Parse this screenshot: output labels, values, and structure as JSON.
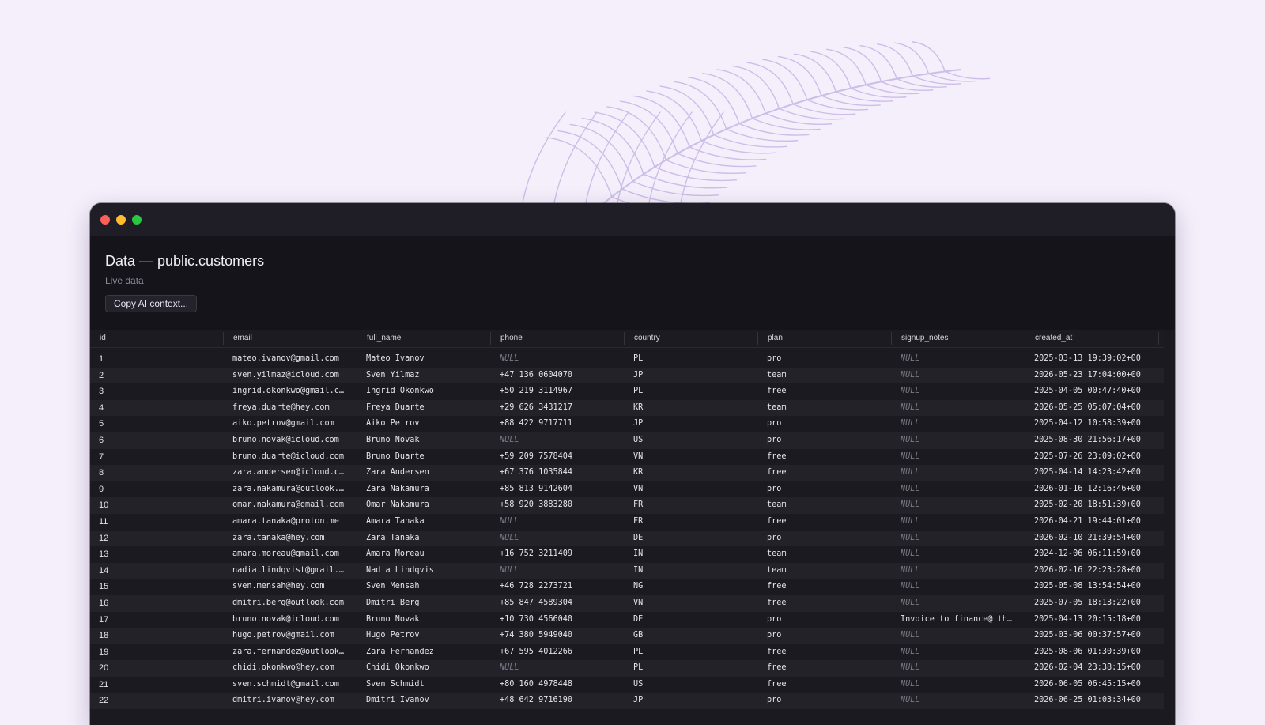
{
  "window": {
    "title": "Data — public.customers",
    "subtitle": "Live data",
    "copy_button_label": "Copy AI context..."
  },
  "table": {
    "columns": [
      "id",
      "email",
      "full_name",
      "phone",
      "country",
      "plan",
      "signup_notes",
      "created_at"
    ],
    "rows": [
      [
        "1",
        "mateo.ivanov@gmail.com",
        "Mateo Ivanov",
        "NULL",
        "PL",
        "pro",
        "NULL",
        "2025-03-13 19:39:02+00"
      ],
      [
        "2",
        "sven.yilmaz@icloud.com",
        "Sven Yilmaz",
        "+47 136 0604070",
        "JP",
        "team",
        "NULL",
        "2026-05-23 17:04:00+00"
      ],
      [
        "3",
        "ingrid.okonkwo@gmail.c…",
        "Ingrid Okonkwo",
        "+50 219 3114967",
        "PL",
        "free",
        "NULL",
        "2025-04-05 00:47:40+00"
      ],
      [
        "4",
        "freya.duarte@hey.com",
        "Freya Duarte",
        "+29 626 3431217",
        "KR",
        "team",
        "NULL",
        "2026-05-25 05:07:04+00"
      ],
      [
        "5",
        "aiko.petrov@gmail.com",
        "Aiko Petrov",
        "+88 422 9717711",
        "JP",
        "pro",
        "NULL",
        "2025-04-12 10:58:39+00"
      ],
      [
        "6",
        "bruno.novak@icloud.com",
        "Bruno Novak",
        "NULL",
        "US",
        "pro",
        "NULL",
        "2025-08-30 21:56:17+00"
      ],
      [
        "7",
        "bruno.duarte@icloud.com",
        "Bruno Duarte",
        "+59 209 7578404",
        "VN",
        "free",
        "NULL",
        "2025-07-26 23:09:02+00"
      ],
      [
        "8",
        "zara.andersen@icloud.c…",
        "Zara Andersen",
        "+67 376 1035844",
        "KR",
        "free",
        "NULL",
        "2025-04-14 14:23:42+00"
      ],
      [
        "9",
        "zara.nakamura@outlook.…",
        "Zara Nakamura",
        "+85 813 9142604",
        "VN",
        "pro",
        "NULL",
        "2026-01-16 12:16:46+00"
      ],
      [
        "10",
        "omar.nakamura@gmail.com",
        "Omar Nakamura",
        "+58 920 3883280",
        "FR",
        "team",
        "NULL",
        "2025-02-20 18:51:39+00"
      ],
      [
        "11",
        "amara.tanaka@proton.me",
        "Amara Tanaka",
        "NULL",
        "FR",
        "free",
        "NULL",
        "2026-04-21 19:44:01+00"
      ],
      [
        "12",
        "zara.tanaka@hey.com",
        "Zara Tanaka",
        "NULL",
        "DE",
        "pro",
        "NULL",
        "2026-02-10 21:39:54+00"
      ],
      [
        "13",
        "amara.moreau@gmail.com",
        "Amara Moreau",
        "+16 752 3211409",
        "IN",
        "team",
        "NULL",
        "2024-12-06 06:11:59+00"
      ],
      [
        "14",
        "nadia.lindqvist@gmail.…",
        "Nadia Lindqvist",
        "NULL",
        "IN",
        "team",
        "NULL",
        "2026-02-16 22:23:28+00"
      ],
      [
        "15",
        "sven.mensah@hey.com",
        "Sven Mensah",
        "+46 728 2273721",
        "NG",
        "free",
        "NULL",
        "2025-05-08 13:54:54+00"
      ],
      [
        "16",
        "dmitri.berg@outlook.com",
        "Dmitri Berg",
        "+85 847 4589304",
        "VN",
        "free",
        "NULL",
        "2025-07-05 18:13:22+00"
      ],
      [
        "17",
        "bruno.novak@icloud.com",
        "Bruno Novak",
        "+10 730 4566040",
        "DE",
        "pro",
        "Invoice to finance@ th…",
        "2025-04-13 20:15:18+00"
      ],
      [
        "18",
        "hugo.petrov@gmail.com",
        "Hugo Petrov",
        "+74 380 5949040",
        "GB",
        "pro",
        "NULL",
        "2025-03-06 00:37:57+00"
      ],
      [
        "19",
        "zara.fernandez@outlook…",
        "Zara Fernandez",
        "+67 595 4012266",
        "PL",
        "free",
        "NULL",
        "2025-08-06 01:30:39+00"
      ],
      [
        "20",
        "chidi.okonkwo@hey.com",
        "Chidi Okonkwo",
        "NULL",
        "PL",
        "free",
        "NULL",
        "2026-02-04 23:38:15+00"
      ],
      [
        "21",
        "sven.schmidt@gmail.com",
        "Sven Schmidt",
        "+80 160 4978448",
        "US",
        "free",
        "NULL",
        "2026-06-05 06:45:15+00"
      ],
      [
        "22",
        "dmitri.ivanov@hey.com",
        "Dmitri Ivanov",
        "+48 642 9716190",
        "JP",
        "pro",
        "NULL",
        "2026-06-25 01:03:34+00"
      ]
    ]
  }
}
